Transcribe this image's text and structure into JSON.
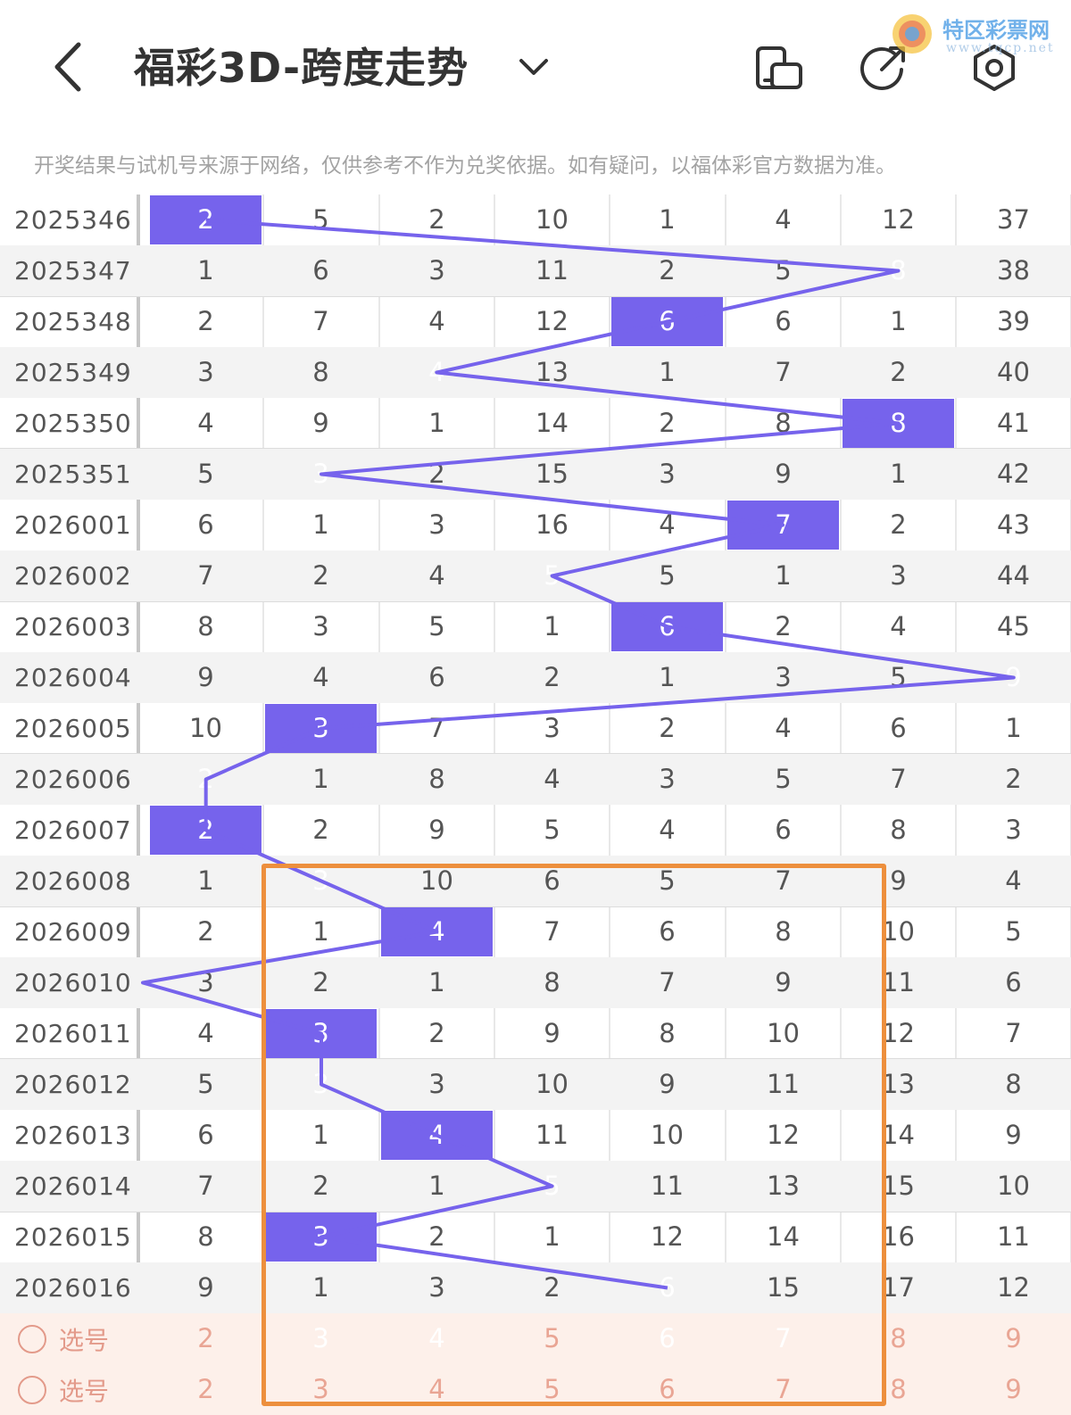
{
  "header": {
    "title": "福彩3D-跨度走势",
    "watermark_name": "特区彩票网",
    "watermark_url": "www.tqcp.net"
  },
  "notice": "开奖结果与试机号来源于网络，仅供参考不作为兑奖依据。如有疑问，以福体彩官方数据为准。",
  "colors": {
    "highlight": "#7663ec",
    "pick": "#ef4040",
    "frame": "#ed8f3d"
  },
  "table": {
    "rows": [
      {
        "issue": "2025346",
        "cells": [
          "2",
          "5",
          "2",
          "10",
          "1",
          "4",
          "12",
          "37"
        ],
        "hit": 0
      },
      {
        "issue": "2025347",
        "cells": [
          "1",
          "6",
          "3",
          "11",
          "2",
          "5",
          "8",
          "38"
        ],
        "hit": 6
      },
      {
        "issue": "2025348",
        "cells": [
          "2",
          "7",
          "4",
          "12",
          "6",
          "6",
          "1",
          "39"
        ],
        "hit": 4
      },
      {
        "issue": "2025349",
        "cells": [
          "3",
          "8",
          "4",
          "13",
          "1",
          "7",
          "2",
          "40"
        ],
        "hit": 2
      },
      {
        "issue": "2025350",
        "cells": [
          "4",
          "9",
          "1",
          "14",
          "2",
          "8",
          "8",
          "41"
        ],
        "hit": 6
      },
      {
        "issue": "2025351",
        "cells": [
          "5",
          "3",
          "2",
          "15",
          "3",
          "9",
          "1",
          "42"
        ],
        "hit": 1
      },
      {
        "issue": "2026001",
        "cells": [
          "6",
          "1",
          "3",
          "16",
          "4",
          "7",
          "2",
          "43"
        ],
        "hit": 5
      },
      {
        "issue": "2026002",
        "cells": [
          "7",
          "2",
          "4",
          "5",
          "5",
          "1",
          "3",
          "44"
        ],
        "hit": 3
      },
      {
        "issue": "2026003",
        "cells": [
          "8",
          "3",
          "5",
          "1",
          "6",
          "2",
          "4",
          "45"
        ],
        "hit": 4
      },
      {
        "issue": "2026004",
        "cells": [
          "9",
          "4",
          "6",
          "2",
          "1",
          "3",
          "5",
          "9"
        ],
        "hit": 7
      },
      {
        "issue": "2026005",
        "cells": [
          "10",
          "3",
          "7",
          "3",
          "2",
          "4",
          "6",
          "1"
        ],
        "hit": 1
      },
      {
        "issue": "2026006",
        "cells": [
          "2",
          "1",
          "8",
          "4",
          "3",
          "5",
          "7",
          "2"
        ],
        "hit": 0
      },
      {
        "issue": "2026007",
        "cells": [
          "2",
          "2",
          "9",
          "5",
          "4",
          "6",
          "8",
          "3"
        ],
        "hit": 0
      },
      {
        "issue": "2026008",
        "cells": [
          "1",
          "3",
          "10",
          "6",
          "5",
          "7",
          "9",
          "4"
        ],
        "hit": 1
      },
      {
        "issue": "2026009",
        "cells": [
          "2",
          "1",
          "4",
          "7",
          "6",
          "8",
          "10",
          "5"
        ],
        "hit": 2
      },
      {
        "issue": "2026010",
        "cells": [
          "3",
          "2",
          "1",
          "8",
          "7",
          "9",
          "11",
          "6"
        ],
        "hit": -1
      },
      {
        "issue": "2026011",
        "cells": [
          "4",
          "3",
          "2",
          "9",
          "8",
          "10",
          "12",
          "7"
        ],
        "hit": 1
      },
      {
        "issue": "2026012",
        "cells": [
          "5",
          "3",
          "3",
          "10",
          "9",
          "11",
          "13",
          "8"
        ],
        "hit": 1
      },
      {
        "issue": "2026013",
        "cells": [
          "6",
          "1",
          "4",
          "11",
          "10",
          "12",
          "14",
          "9"
        ],
        "hit": 2
      },
      {
        "issue": "2026014",
        "cells": [
          "7",
          "2",
          "1",
          "5",
          "11",
          "13",
          "15",
          "10"
        ],
        "hit": 3
      },
      {
        "issue": "2026015",
        "cells": [
          "8",
          "3",
          "2",
          "1",
          "12",
          "14",
          "16",
          "11"
        ],
        "hit": 1
      },
      {
        "issue": "2026016",
        "cells": [
          "9",
          "1",
          "3",
          "2",
          "6",
          "15",
          "17",
          "12"
        ],
        "hit": 4
      }
    ],
    "pick_rows": [
      {
        "label": "选号",
        "cells": [
          "2",
          "3",
          "4",
          "5",
          "6",
          "7",
          "8",
          "9"
        ],
        "red": [
          1,
          2,
          4,
          5
        ]
      },
      {
        "label": "选号",
        "cells": [
          "2",
          "3",
          "4",
          "5",
          "6",
          "7",
          "8",
          "9"
        ],
        "red": []
      }
    ]
  }
}
